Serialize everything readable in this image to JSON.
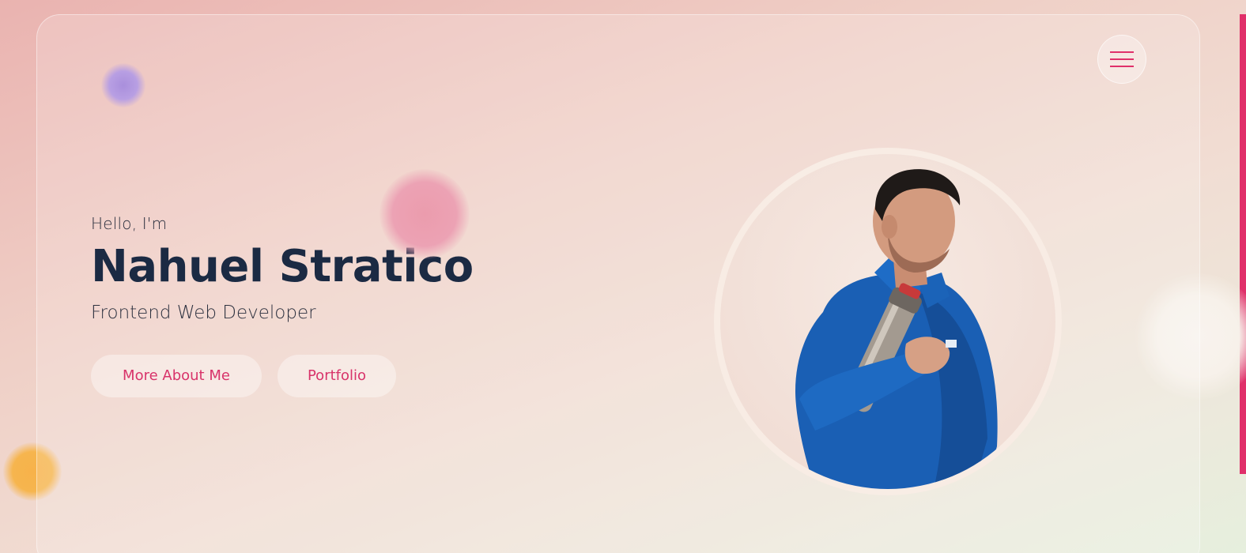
{
  "header": {
    "menu_icon": "hamburger-menu-icon"
  },
  "hero": {
    "greeting": "Hello, I'm",
    "name": "Nahuel Stratico",
    "role": "Frontend Web Developer",
    "buttons": [
      {
        "label": "More About Me"
      },
      {
        "label": "Portfolio"
      }
    ]
  },
  "portrait": {
    "description_icon": "profile-photo"
  },
  "colors": {
    "accent": "#e0306a",
    "heading": "#1b2a43",
    "body_text": "#2e3240",
    "button_text": "#d8336a"
  }
}
